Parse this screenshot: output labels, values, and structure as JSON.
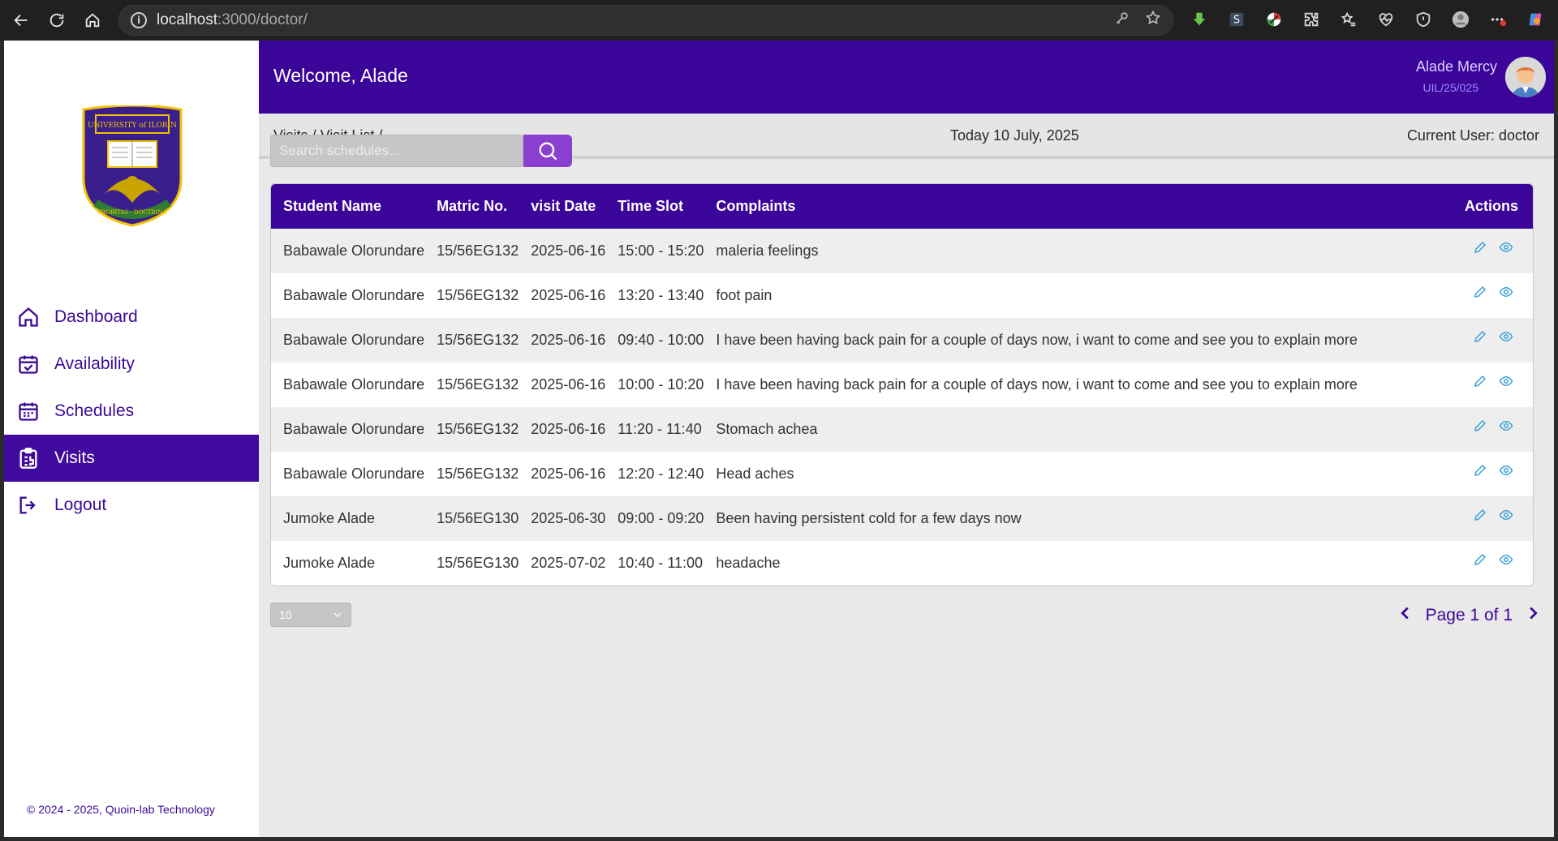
{
  "browser": {
    "url_host": "localhost",
    "url_rest": ":3000/doctor/"
  },
  "sidebar": {
    "items": [
      {
        "label": "Dashboard",
        "icon": "home-icon"
      },
      {
        "label": "Availability",
        "icon": "calendar-check-icon"
      },
      {
        "label": "Schedules",
        "icon": "calendar-icon"
      },
      {
        "label": "Visits",
        "icon": "clipboard-icon",
        "active": true
      },
      {
        "label": "Logout",
        "icon": "logout-icon"
      }
    ],
    "footer": "© 2024 - 2025, Quoin-lab Technology",
    "logo_text_top": "UNIVERSITY of ILORIN",
    "logo_text_bottom": "PROBITAS · DOCTRINA"
  },
  "header": {
    "welcome": "Welcome, Alade",
    "user_name": "Alade Mercy",
    "user_id": "UIL/25/025"
  },
  "crumbbar": {
    "breadcrumb": "Visits / Visit List /",
    "today": "Today 10 July, 2025",
    "current_user": "Current User: doctor"
  },
  "search": {
    "placeholder": "Search schedules..."
  },
  "table": {
    "headers": {
      "name": "Student Name",
      "matric": "Matric No.",
      "date": "visit Date",
      "slot": "Time Slot",
      "complaints": "Complaints",
      "actions": "Actions"
    },
    "rows": [
      {
        "name": "Babawale Olorundare",
        "matric": "15/56EG132",
        "date": "2025-06-16",
        "slot": "15:00 - 15:20",
        "complaints": "maleria feelings"
      },
      {
        "name": "Babawale Olorundare",
        "matric": "15/56EG132",
        "date": "2025-06-16",
        "slot": "13:20 - 13:40",
        "complaints": "foot pain"
      },
      {
        "name": "Babawale Olorundare",
        "matric": "15/56EG132",
        "date": "2025-06-16",
        "slot": "09:40 - 10:00",
        "complaints": "I have been having back pain for a couple of days now, i want to come and see you to explain more"
      },
      {
        "name": "Babawale Olorundare",
        "matric": "15/56EG132",
        "date": "2025-06-16",
        "slot": "10:00 - 10:20",
        "complaints": "I have been having back pain for a couple of days now, i want to come and see you to explain more"
      },
      {
        "name": "Babawale Olorundare",
        "matric": "15/56EG132",
        "date": "2025-06-16",
        "slot": "11:20 - 11:40",
        "complaints": "Stomach achea"
      },
      {
        "name": "Babawale Olorundare",
        "matric": "15/56EG132",
        "date": "2025-06-16",
        "slot": "12:20 - 12:40",
        "complaints": "Head aches"
      },
      {
        "name": "Jumoke Alade",
        "matric": "15/56EG130",
        "date": "2025-06-30",
        "slot": "09:00 - 09:20",
        "complaints": "Been having persistent cold for a few days now"
      },
      {
        "name": "Jumoke Alade",
        "matric": "15/56EG130",
        "date": "2025-07-02",
        "slot": "10:40 - 11:00",
        "complaints": "headache"
      }
    ]
  },
  "pagination": {
    "page_size": "10",
    "label": "Page 1 of 1"
  },
  "colors": {
    "primary": "#3c0599",
    "search_button": "#8a3fd0",
    "action_icon": "#3aa0d8"
  }
}
